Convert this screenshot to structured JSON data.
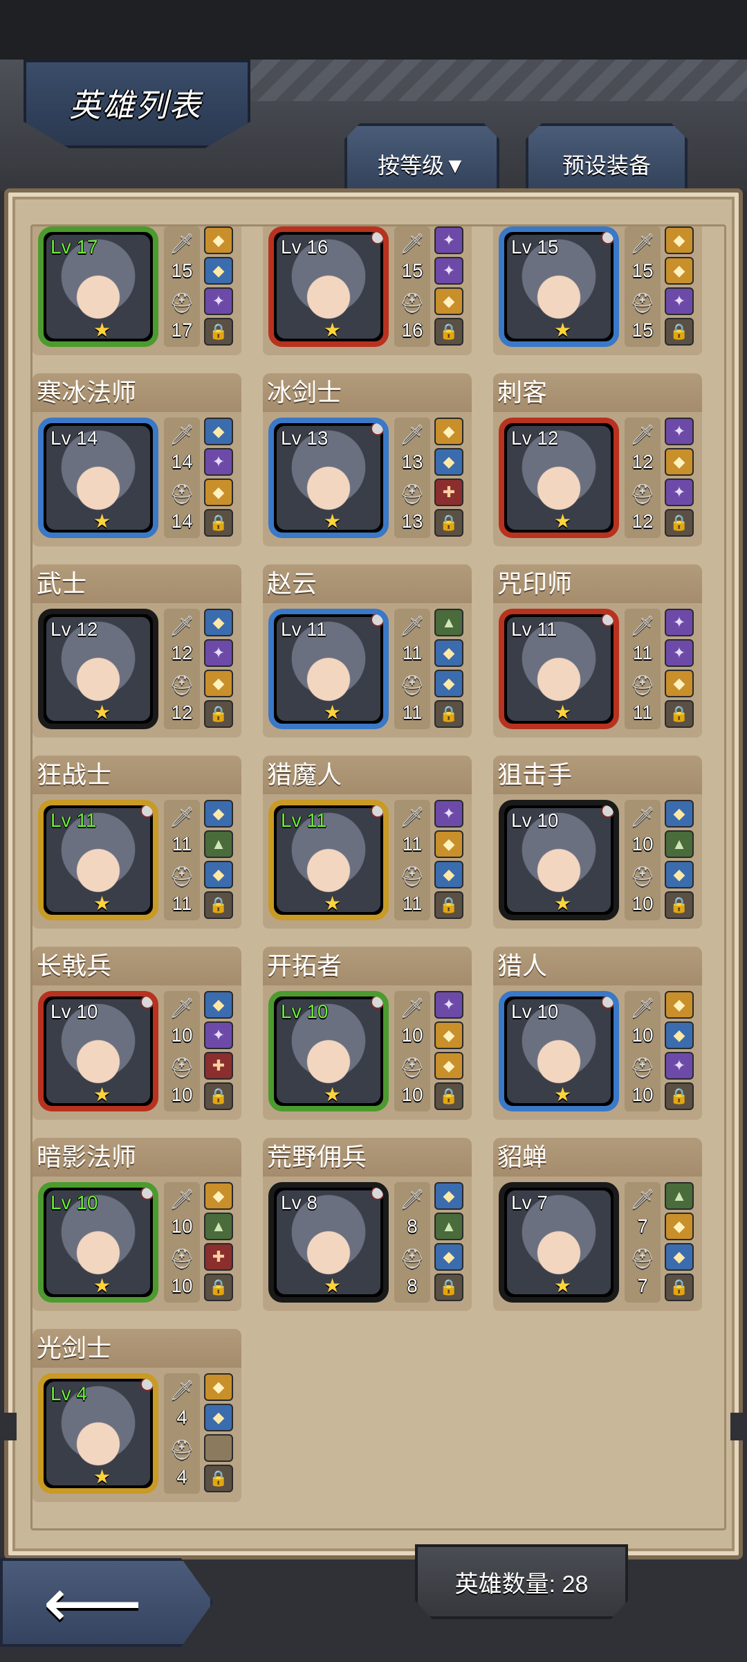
{
  "header": {
    "title": "英雄列表"
  },
  "buttons": {
    "sort_label": "按等级▼",
    "preset_label": "预设装备"
  },
  "footer": {
    "hero_count": "英雄数量: 28"
  },
  "heroes": [
    {
      "name": "",
      "level": "Lv 17",
      "attack": "15",
      "defense": "17",
      "frame": "green",
      "red_dot": false,
      "slots": [
        "gold",
        "blue",
        "purple"
      ]
    },
    {
      "name": "",
      "level": "Lv 16",
      "attack": "15",
      "defense": "16",
      "frame": "red",
      "red_dot": true,
      "slots": [
        "purple",
        "purple",
        "gold"
      ]
    },
    {
      "name": "",
      "level": "Lv 15",
      "attack": "15",
      "defense": "15",
      "frame": "blue",
      "red_dot": true,
      "slots": [
        "gold",
        "gold",
        "purple"
      ]
    },
    {
      "name": "寒冰法师",
      "level": "Lv 14",
      "attack": "14",
      "defense": "14",
      "frame": "blue",
      "red_dot": false,
      "slots": [
        "blue",
        "purple",
        "gold"
      ]
    },
    {
      "name": "冰剑士",
      "level": "Lv 13",
      "attack": "13",
      "defense": "13",
      "frame": "blue",
      "red_dot": true,
      "slots": [
        "gold",
        "blue",
        "red"
      ]
    },
    {
      "name": "刺客",
      "level": "Lv 12",
      "attack": "12",
      "defense": "12",
      "frame": "red",
      "red_dot": false,
      "slots": [
        "purple",
        "gold",
        "purple"
      ]
    },
    {
      "name": "武士",
      "level": "Lv 12",
      "attack": "12",
      "defense": "12",
      "frame": "black",
      "red_dot": false,
      "slots": [
        "blue",
        "purple",
        "gold"
      ]
    },
    {
      "name": "赵云",
      "level": "Lv 11",
      "attack": "11",
      "defense": "11",
      "frame": "blue",
      "red_dot": true,
      "slots": [
        "green",
        "blue",
        "blue"
      ]
    },
    {
      "name": "咒印师",
      "level": "Lv 11",
      "attack": "11",
      "defense": "11",
      "frame": "red",
      "red_dot": true,
      "slots": [
        "purple",
        "purple",
        "gold"
      ]
    },
    {
      "name": "狂战士",
      "level": "Lv 11",
      "attack": "11",
      "defense": "11",
      "frame": "gold",
      "red_dot": true,
      "slots": [
        "blue",
        "green",
        "blue"
      ]
    },
    {
      "name": "猎魔人",
      "level": "Lv 11",
      "attack": "11",
      "defense": "11",
      "frame": "gold",
      "red_dot": true,
      "slots": [
        "purple",
        "gold",
        "blue"
      ]
    },
    {
      "name": "狙击手",
      "level": "Lv 10",
      "attack": "10",
      "defense": "10",
      "frame": "black",
      "red_dot": true,
      "slots": [
        "blue",
        "green",
        "blue"
      ]
    },
    {
      "name": "长戟兵",
      "level": "Lv 10",
      "attack": "10",
      "defense": "10",
      "frame": "red",
      "red_dot": true,
      "slots": [
        "blue",
        "purple",
        "red"
      ]
    },
    {
      "name": "开拓者",
      "level": "Lv 10",
      "attack": "10",
      "defense": "10",
      "frame": "green",
      "red_dot": true,
      "slots": [
        "purple",
        "gold",
        "gold"
      ]
    },
    {
      "name": "猎人",
      "level": "Lv 10",
      "attack": "10",
      "defense": "10",
      "frame": "blue",
      "red_dot": true,
      "slots": [
        "gold",
        "blue",
        "purple"
      ]
    },
    {
      "name": "暗影法师",
      "level": "Lv 10",
      "attack": "10",
      "defense": "10",
      "frame": "green",
      "red_dot": true,
      "slots": [
        "gold",
        "green",
        "red"
      ]
    },
    {
      "name": "荒野佣兵",
      "level": "Lv 8",
      "attack": "8",
      "defense": "8",
      "frame": "black",
      "red_dot": true,
      "slots": [
        "blue",
        "green",
        "blue"
      ]
    },
    {
      "name": "貂蝉",
      "level": "Lv 7",
      "attack": "7",
      "defense": "7",
      "frame": "black",
      "red_dot": false,
      "slots": [
        "green",
        "gold",
        "blue"
      ]
    },
    {
      "name": "光剑士",
      "level": "Lv 4",
      "attack": "4",
      "defense": "4",
      "frame": "gold",
      "red_dot": true,
      "slots": [
        "gold",
        "blue",
        "empty"
      ]
    }
  ]
}
